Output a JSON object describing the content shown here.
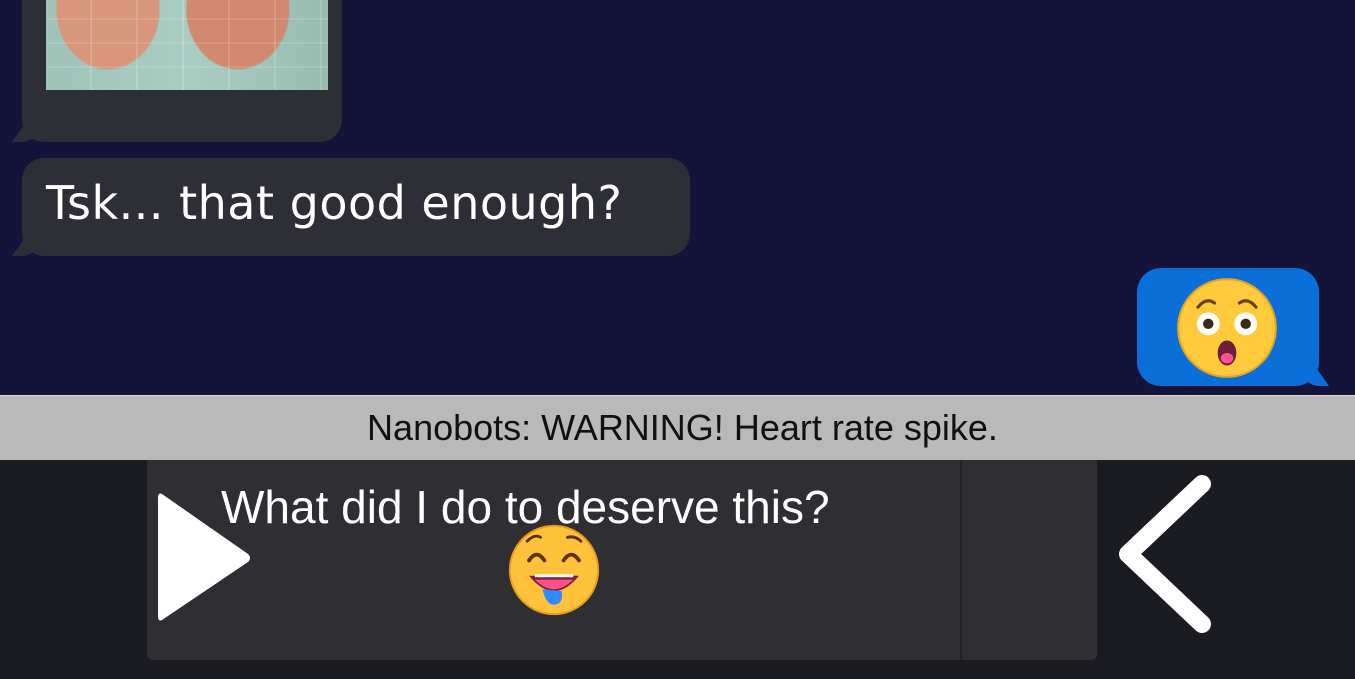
{
  "chat": {
    "messages": [
      {
        "side": "incoming",
        "type": "image",
        "description": ""
      },
      {
        "side": "incoming",
        "type": "text",
        "text": "Tsk... that good enough?"
      },
      {
        "side": "outgoing",
        "type": "emoji",
        "icon": "astonished-face-emoji"
      }
    ]
  },
  "banner": {
    "text": "Nanobots: WARNING! Heart rate spike."
  },
  "dialog": {
    "text": "What did I do to deserve this?",
    "emoji_icon": "drooling-face-emoji"
  },
  "controls": {
    "play_icon": "play-icon",
    "back_icon": "chevron-left-icon"
  },
  "colors": {
    "background": "#14143a",
    "incoming_bubble": "#2e2e36",
    "outgoing_bubble": "#0a6fd8",
    "banner": "#b9b9b9",
    "dialog_box": "#2f2f33"
  }
}
